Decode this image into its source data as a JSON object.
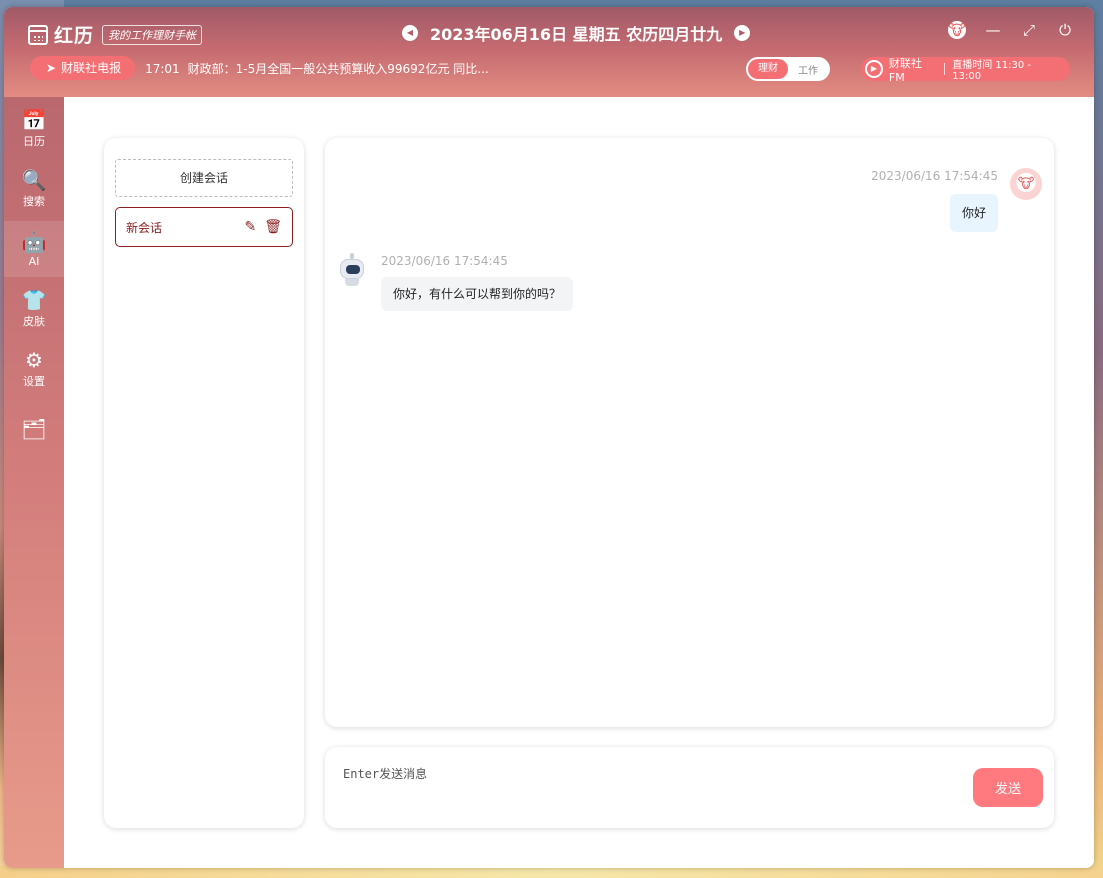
{
  "app": {
    "name": "红历",
    "slogan": "我的工作理财手帐"
  },
  "header": {
    "date": "2023年06月16日 星期五 农历四月廿九",
    "prev_icon": "◀",
    "next_icon": "▶",
    "news_tag": "财联社电报",
    "news_time": "17:01",
    "news_text": "财政部：1-5月全国一般公共预算收入99692亿元 同比...",
    "toggle_active": "理财",
    "toggle_inactive": "工作",
    "fm_name": "财联社FM",
    "fm_time": "直播时间 11:30 - 13:00"
  },
  "window_controls": {
    "mascot": "🐮",
    "minimize": "—",
    "maximize": "⤢",
    "power": "⏻"
  },
  "sidebar": {
    "items": [
      {
        "label": "日历",
        "icon": "📅"
      },
      {
        "label": "搜索",
        "icon": "🔍"
      },
      {
        "label": "AI",
        "icon": "🤖"
      },
      {
        "label": "皮肤",
        "icon": "👕"
      },
      {
        "label": "设置",
        "icon": "⚙"
      },
      {
        "label": "",
        "icon": "🗂"
      }
    ]
  },
  "sessions": {
    "create_label": "创建会话",
    "items": [
      {
        "name": "新会话"
      }
    ]
  },
  "chat": {
    "messages": [
      {
        "role": "user",
        "time": "2023/06/16 17:54:45",
        "text": "你好"
      },
      {
        "role": "bot",
        "time": "2023/06/16 17:54:45",
        "text": "你好，有什么可以帮到你的吗？"
      }
    ],
    "input_placeholder": "Enter发送消息",
    "send_label": "发送"
  },
  "colors": {
    "accent": "#f46f74",
    "active_session": "#8a1f1f",
    "user_bubble": "#e8f5ff",
    "bot_bubble": "#f3f4f6"
  }
}
